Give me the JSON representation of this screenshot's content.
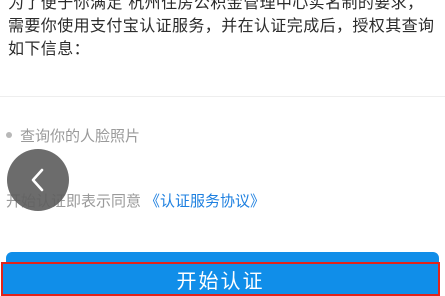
{
  "intro": {
    "line1": "为了便于你满足 杭州住房公积金管理中心实名制的要求，",
    "line2": "需要你使用支付宝认证服务，并在认证完成后，授权其查询",
    "line3": "如下信息："
  },
  "info_items": [
    {
      "label": "查询你的人脸照片"
    }
  ],
  "back_button": {
    "icon": "chevron-left-icon"
  },
  "agreement": {
    "text": "开始认证即表示同意",
    "link": "《认证服务协议》"
  },
  "cta": {
    "label": "开始认证"
  },
  "colors": {
    "primary": "#108ee9",
    "link": "#1e80e0",
    "highlight_border": "#e2231a",
    "muted_text": "#9a9a9a",
    "body_text": "#2b2b2b"
  }
}
